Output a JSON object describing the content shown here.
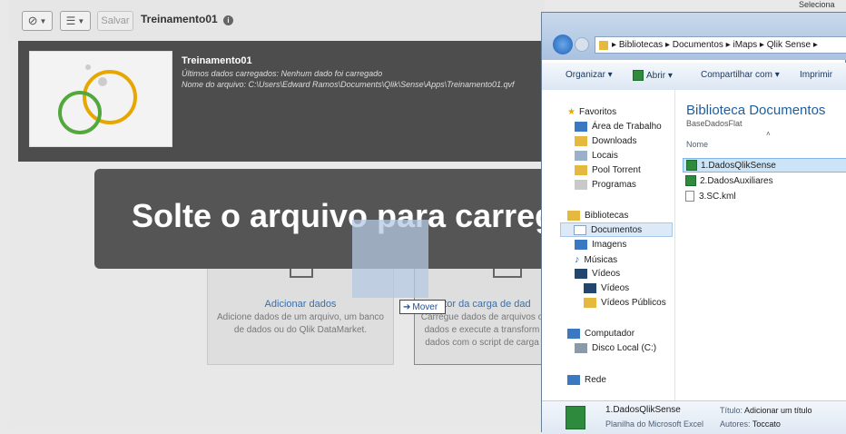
{
  "qlik": {
    "save_label": "Salvar",
    "app_title": "Treinamento01",
    "header": {
      "title": "Treinamento01",
      "last_loaded": "Últimos dados carregados: Nenhum dado foi carregado",
      "file_name": "Nome do arquivo: C:\\Users\\Edward Ramos\\Documents\\Qlik\\Sense\\Apps\\Treinamento01.qvf"
    },
    "drop_overlay": "Solte o arquivo para carreg",
    "cards": [
      {
        "title": "Adicionar dados",
        "desc": "Adicione dados de um arquivo, um banco de dados ou do Qlik DataMarket."
      },
      {
        "title": "Editor da carga de dad",
        "desc": "Carregue dados de arquivos o dados e execute a transform dados com o script de carga"
      }
    ],
    "drag_tooltip": "Mover"
  },
  "explorer": {
    "corner_text": "Seleciona",
    "breadcrumb": [
      "Bibliotecas",
      "Documentos",
      "iMaps",
      "Qlik Sense"
    ],
    "commands": {
      "organize": "Organizar ▾",
      "open": "Abrir ▾",
      "share": "Compartilhar com ▾",
      "print": "Imprimir"
    },
    "nav": {
      "favorites_header": "Favoritos",
      "favorites": [
        "Área de Trabalho",
        "Downloads",
        "Locais",
        "Pool Torrent",
        "Programas"
      ],
      "libraries_header": "Bibliotecas",
      "libraries": [
        "Documentos",
        "Imagens",
        "Músicas",
        "Vídeos"
      ],
      "videos_sub": [
        "Vídeos",
        "Vídeos Públicos"
      ],
      "computer_header": "Computador",
      "computer": [
        "Disco Local (C:)"
      ],
      "network_header": "Rede"
    },
    "content": {
      "title": "Biblioteca Documentos",
      "subtitle": "BaseDadosFlat",
      "column": "Nome",
      "files": [
        "1.DadosQlikSense",
        "2.DadosAuxiliares",
        "3.SC.kml"
      ]
    },
    "details": {
      "name": "1.DadosQlikSense",
      "type": "Planilha do Microsoft Excel",
      "title_label": "Título:",
      "title_value": "Adicionar um título",
      "authors_label": "Autores:",
      "authors_value": "Toccato"
    }
  }
}
